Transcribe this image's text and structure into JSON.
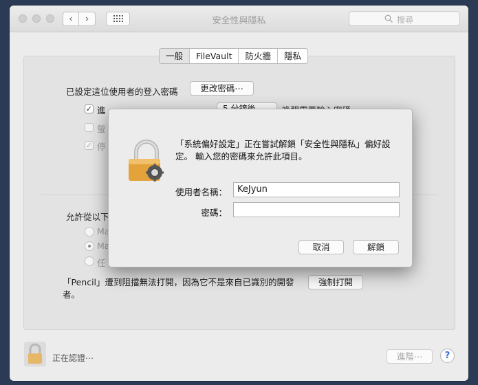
{
  "window": {
    "title": "安全性與隱私",
    "search_placeholder": "搜尋",
    "nav_back": "‹",
    "nav_forward": "›"
  },
  "tabs": [
    "一般",
    "FileVault",
    "防火牆",
    "隱私"
  ],
  "general": {
    "password_set_label": "已設定這位使用者的登入密碼",
    "change_password_button": "更改密碼⋯",
    "require_password_label_visible": "進",
    "require_password_label_tail": "喚醒需要輸入密碼",
    "require_password_delay": "5 分鐘後",
    "show_message_label": "螢",
    "disable_auto_login_label": "停",
    "require_password_checked": true,
    "show_message_checked": false,
    "disable_auto_login_checked": true
  },
  "allow_apps": {
    "label": "允許從以下",
    "options": [
      "Ma",
      "Ma",
      "任"
    ],
    "selected_index": 1,
    "blocked_message": "「Pencil」遭到阻擋無法打開，因為它不是來自已識別的開發者。",
    "open_anyway_button": "強制打開"
  },
  "footer": {
    "status": "正在認證⋯",
    "advanced_button": "進階⋯",
    "help_button": "?"
  },
  "dialog": {
    "message": "「系統偏好設定」正在嘗試解鎖「安全性與隱私」偏好設定。 輸入您的密碼來允許此項目。",
    "username_label": "使用者名稱：",
    "username_value": "KeJyun",
    "password_label": "密碼：",
    "password_value": "",
    "cancel_button": "取消",
    "unlock_button": "解鎖"
  },
  "colors": {
    "lock_gold": "#e6a53a",
    "accent_blue": "#3b6fd6"
  }
}
